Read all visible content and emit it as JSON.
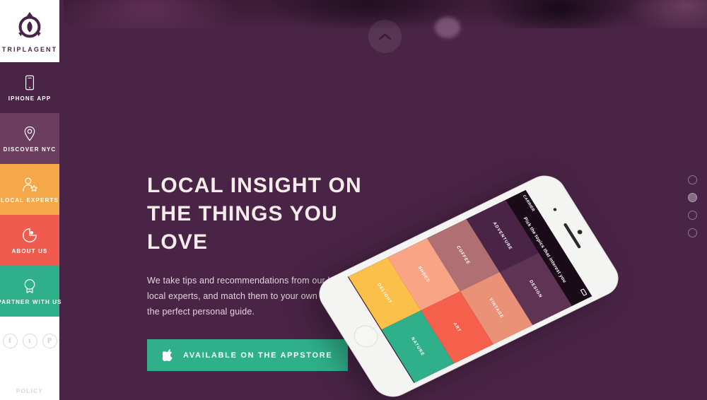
{
  "brand": {
    "name": "TRIPLAGENT",
    "logo_icon": "compass-leaf-logo"
  },
  "sidebar": {
    "items": [
      {
        "label": "IPHONE APP",
        "icon": "phone-icon",
        "color": "#4a2447"
      },
      {
        "label": "DISCOVER NYC",
        "icon": "map-pin-icon",
        "color": "#6b3d5e"
      },
      {
        "label": "LOCAL EXPERTS",
        "icon": "person-star-icon",
        "color": "#f5a84a"
      },
      {
        "label": "ABOUT US",
        "icon": "speech-bubble-icon",
        "color": "#f05b4f"
      },
      {
        "label": "PARTNER WITH US",
        "icon": "badge-ribbon-icon",
        "color": "#2fb08a"
      }
    ],
    "social": [
      {
        "name": "facebook-icon",
        "glyph": "f"
      },
      {
        "name": "twitter-icon",
        "glyph": "t"
      },
      {
        "name": "pinterest-icon",
        "glyph": "P"
      }
    ],
    "policy_label": "POLICY"
  },
  "hero": {
    "heading_line1": "LOCAL INSIGHT ON",
    "heading_line2": "THE THINGS YOU LOVE",
    "body": "We take tips and recommendations from our hand-picked local experts, and match them to your own interests, for the perfect personal guide.",
    "cta_label": "AVAILABLE ON THE APPSTORE",
    "cta_icon": "apple-logo-icon",
    "cta_color": "#2fb08a"
  },
  "scroll": {
    "up_icon": "chevron-up-icon",
    "down_icon": "chevron-down-icon"
  },
  "pagination": {
    "total": 4,
    "active_index": 2
  },
  "phone": {
    "status_carrier": "CARRIER",
    "app_header": "Pick the topics that interest you",
    "tiles": [
      {
        "label": "ADVENTURE",
        "color": "#4a2447"
      },
      {
        "label": "DESIGN",
        "color": "#5e3354"
      },
      {
        "label": "COFFEE",
        "color": "#b06f72"
      },
      {
        "label": "VINTAGE",
        "color": "#e99277"
      },
      {
        "label": "SHOES",
        "color": "#f9a585"
      },
      {
        "label": "ART",
        "color": "#f4604c"
      },
      {
        "label": "DELIGHT",
        "color": "#fbc04a"
      },
      {
        "label": "NATURE",
        "color": "#2fb08a"
      }
    ]
  },
  "theme": {
    "background": "#4a2447",
    "text_light": "#f3ece9"
  }
}
